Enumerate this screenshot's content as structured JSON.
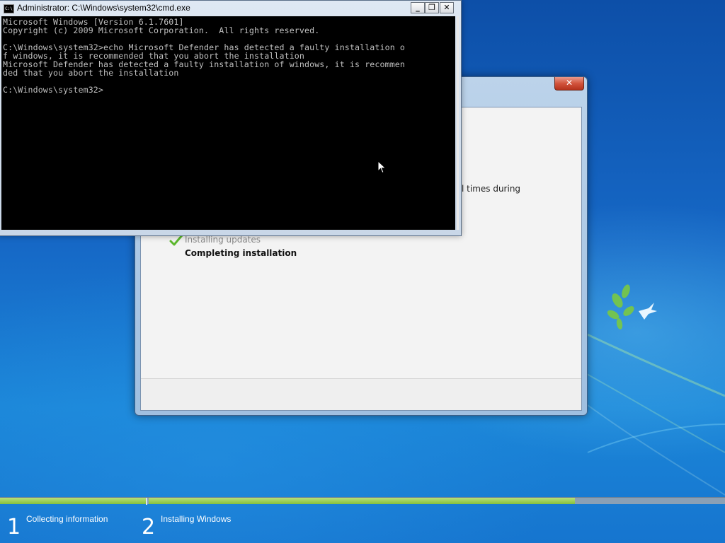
{
  "cmd": {
    "title": "Administrator: C:\\Windows\\system32\\cmd.exe",
    "icon_label": "C:\\",
    "buttons": {
      "minimize": "_",
      "restore": "❐",
      "close": "✕"
    },
    "lines": [
      "Microsoft Windows [Version 6.1.7601]",
      "Copyright (c) 2009 Microsoft Corporation.  All rights reserved.",
      "",
      "C:\\Windows\\system32>echo Microsoft Defender has detected a faulty installation o",
      "f windows, it is recommended that you abort the installation",
      "Microsoft Defender has detected a faulty installation of windows, it is recommen",
      "ded that you abort the installation",
      "",
      "C:\\Windows\\system32>"
    ]
  },
  "setup": {
    "close_label": "✕",
    "text_fragment": "l times during",
    "steps": {
      "done": "Installing updates",
      "current": "Completing installation"
    }
  },
  "progress": {
    "step1": {
      "number": "1",
      "label": "Collecting information",
      "fill": 1.0
    },
    "step2": {
      "number": "2",
      "label": "Installing Windows",
      "fill": 0.74
    }
  },
  "colors": {
    "progress_fill": "#86c03c",
    "console_bg": "#000000",
    "console_text": "#c0c0c0"
  }
}
